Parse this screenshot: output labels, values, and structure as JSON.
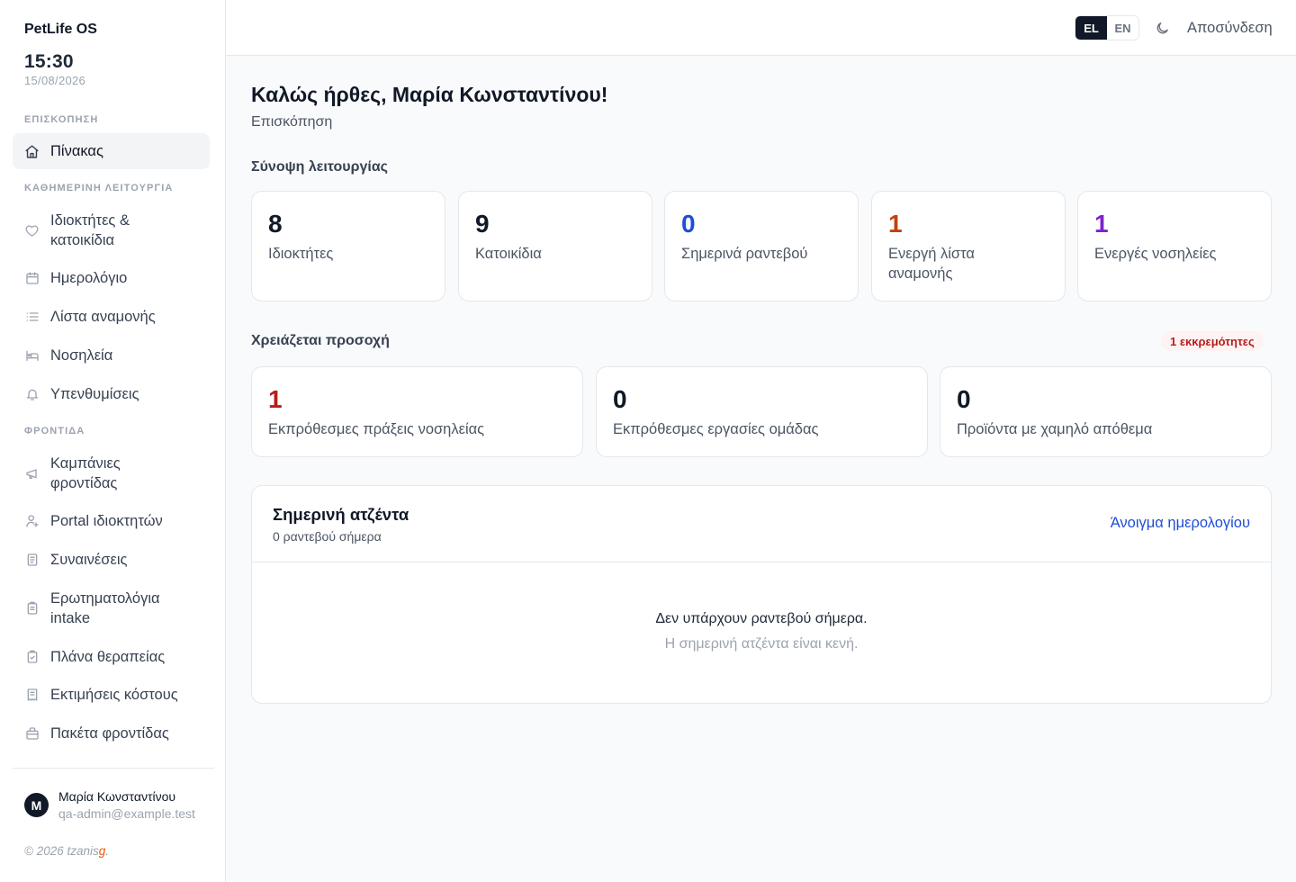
{
  "app": {
    "brand": "PetLife OS",
    "time": "15:30",
    "date": "15/08/2026"
  },
  "sidebar": {
    "sections": {
      "overview": "ΕΠΙΣΚΟΠΗΣΗ",
      "daily": "ΚΑΘΗΜΕΡΙΝΗ ΛΕΙΤΟΥΡΓΙΑ",
      "care": "ΦΡΟΝΤΙΔΑ"
    },
    "items": [
      {
        "label": "Πίνακας",
        "icon": "home-icon",
        "active": true
      },
      {
        "label": "Ιδιοκτήτες & κατοικίδια",
        "icon": "heart-icon"
      },
      {
        "label": "Ημερολόγιο",
        "icon": "calendar-icon"
      },
      {
        "label": "Λίστα αναμονής",
        "icon": "list-icon"
      },
      {
        "label": "Νοσηλεία",
        "icon": "bed-icon"
      },
      {
        "label": "Υπενθυμίσεις",
        "icon": "bell-icon"
      },
      {
        "label": "Καμπάνιες φροντίδας",
        "icon": "megaphone-icon"
      },
      {
        "label": "Portal ιδιοκτητών",
        "icon": "user-portal-icon"
      },
      {
        "label": "Συναινέσεις",
        "icon": "document-icon"
      },
      {
        "label": "Ερωτηματολόγια intake",
        "icon": "clipboard-icon"
      },
      {
        "label": "Πλάνα θεραπείας",
        "icon": "clipboard-check-icon"
      },
      {
        "label": "Εκτιμήσεις κόστους",
        "icon": "receipt-icon"
      },
      {
        "label": "Πακέτα φροντίδας",
        "icon": "package-icon"
      }
    ],
    "user": {
      "initial": "M",
      "name": "Μαρία Κωνσταντίνου",
      "email": "qa-admin@example.test"
    },
    "footer": {
      "copyright": "© 2026 tzanis",
      "accent": "g",
      "dot": "."
    }
  },
  "topbar": {
    "languages": [
      "EL",
      "EN"
    ],
    "active_language": "EL",
    "theme_icon": "moon-icon",
    "logout": "Αποσύνδεση"
  },
  "main": {
    "title": "Καλώς ήρθες, Μαρία Κωνσταντίνου!",
    "subtitle": "Επισκόπηση",
    "summary_heading": "Σύνοψη λειτουργίας",
    "summary": [
      {
        "value": "8",
        "label": "Ιδιοκτήτες",
        "color": "#111827"
      },
      {
        "value": "9",
        "label": "Κατοικίδια",
        "color": "#111827"
      },
      {
        "value": "0",
        "label": "Σημερινά ραντεβού",
        "color": "#1d4ed8"
      },
      {
        "value": "1",
        "label": "Ενεργή λίστα αναμονής",
        "color": "#c2410c"
      },
      {
        "value": "1",
        "label": "Ενεργές νοσηλείες",
        "color": "#7e22ce"
      }
    ],
    "attention_heading": "Χρειάζεται προσοχή",
    "pending_badge": "1 εκκρεμότητες",
    "attention": [
      {
        "value": "1",
        "label": "Εκπρόθεσμες πράξεις νοσηλείας",
        "color": "#b91c1c"
      },
      {
        "value": "0",
        "label": "Εκπρόθεσμες εργασίες ομάδας",
        "color": "#111827"
      },
      {
        "value": "0",
        "label": "Προϊόντα με χαμηλό απόθεμα",
        "color": "#111827"
      }
    ],
    "agenda": {
      "title": "Σημερινή ατζέντα",
      "count": "0 ραντεβού σήμερα",
      "link": "Άνοιγμα ημερολογίου",
      "empty_title": "Δεν υπάρχουν ραντεβού σήμερα.",
      "empty_sub": "Η σημερινή ατζέντα είναι κενή."
    }
  },
  "colors": {
    "accent_blue": "#1d4ed8",
    "danger": "#b91c1c",
    "orange": "#c2410c",
    "purple": "#7e22ce",
    "brand_accent": "#ea580c"
  }
}
